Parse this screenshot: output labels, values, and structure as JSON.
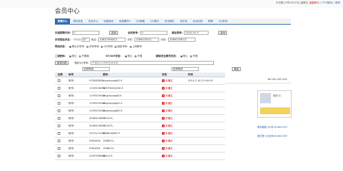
{
  "top": {
    "text": "今天是[19年2月15日] 星期五",
    "warn": "温馨提示",
    "links": "[7755服务] | 登录"
  },
  "title": "会员中心",
  "nav": [
    "管理中心",
    "资料信息",
    "安全中心",
    "免费版块",
    "免费模块2",
    "QQ邮箱",
    "QQ助手",
    "安全模式",
    "会员谈",
    "自动加钱",
    "群聊",
    "QQ查询"
  ],
  "filter": {
    "date_label": "日结期限时间：",
    "date_val": "0",
    "date_btn": "查询",
    "amount_label": "会员账号：",
    "amount_val": "0",
    "last_label": "最后登录：",
    "last_val": "2014-10-3",
    "qq_label": "手机短信状态：",
    "qq_a": "GTQQ",
    "qq_b": "QT",
    "phone_label": "电话：",
    "phone_val": "10637598023",
    "mobile_label": "手机：",
    "mobile_val": "1069070011",
    "fax_label": "传真：",
    "fax_val": "10690709012",
    "type_label": "筛选状态：",
    "type_opts": [
      "默认手机号",
      "手机号码",
      "QQ号码",
      "固定号码",
      "上网账号"
    ],
    "r1_label": "二级密码：",
    "r1_opts": [
      "禁止",
      "不限制"
    ],
    "r2_label": "GT/SSF状态：",
    "r2_opts": [
      "禁止",
      "不限"
    ],
    "r3_label": "解除安全模式状态：",
    "r3_opts": [
      "禁止",
      "不限"
    ],
    "list_btn": "登录列表",
    "qq_num_label": "指定QQ号码：",
    "qq_num_hint": "不指定QQ号码查询全部",
    "select_a": "选择筛选",
    "select_b": "选择筛选",
    "confirm": "确定"
  },
  "table": {
    "headers": [
      "选择",
      "帐号",
      "",
      "密码 ·",
      "状态",
      "时间"
    ],
    "rows": [
      {
        "acct": "帐号：",
        "num": "976289838",
        "pwd": "wugroupqq82.0",
        "status": "未通过",
        "time": "2014-2-18 21:00:09"
      },
      {
        "acct": "帐号：",
        "num": "1195528438",
        "pwd": "WGYONGQ282.9",
        "status": "未通过",
        "time": ""
      },
      {
        "acct": "帐号：",
        "num": "1195529438",
        "pwd": "wugroupqq824",
        "status": "未通过",
        "time": ""
      },
      {
        "acct": "帐号：",
        "num": "1195529438",
        "pwd": "wugroupqq82.0",
        "status": "未通过",
        "time": ""
      },
      {
        "acct": "帐号：",
        "num": "1195529438",
        "pwd": "wugroupqq82.0",
        "status": "未通过",
        "time": ""
      },
      {
        "acct": "帐号：",
        "num": "2948323836",
        "pwd": "123123,",
        "status": "未通过",
        "time": ""
      },
      {
        "acct": "帐号：",
        "num": "2948323836",
        "pwd": "123123,",
        "status": "未通过",
        "time": ""
      },
      {
        "acct": "帐号：",
        "num": "2319113194",
        "pwd": "836816836.**",
        "status": "未通过",
        "time": ""
      },
      {
        "acct": "帐号：",
        "num": "5961836",
        "pwd": "1986231.",
        "status": "未通过",
        "time": ""
      },
      {
        "acct": "帐号：",
        "num": "5961836",
        "pwd": "1986231.",
        "status": "未通过",
        "time": ""
      },
      {
        "acct": "帐号：",
        "num": "2309768968",
        "pwd": "bbb123",
        "status": "未通过",
        "time": ""
      }
    ]
  },
  "right": {
    "ip": "36.150.105.203",
    "panel_title": "咱的QQ",
    "qq_line": "联系客服 QQ号:614631597",
    "qq_line2": "我们是 QQ空间:614631597"
  }
}
